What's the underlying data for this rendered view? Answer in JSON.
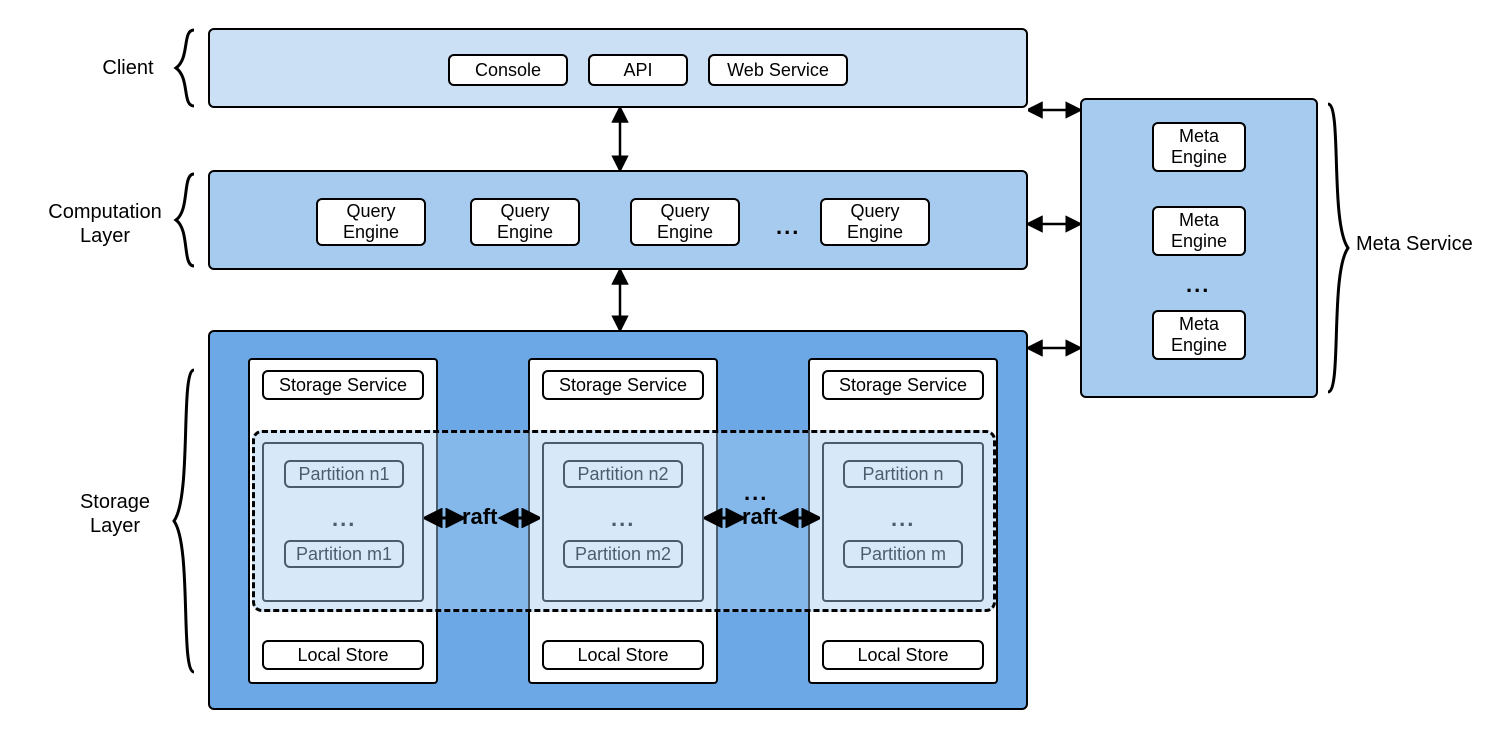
{
  "labels": {
    "client": "Client",
    "compute": "Computation\nLayer",
    "storage": "Storage\nLayer",
    "meta": "Meta Service"
  },
  "client_row": {
    "console": "Console",
    "api": "API",
    "web": "Web Service"
  },
  "compute_row": {
    "qe": "Query\nEngine"
  },
  "ellipsis": "...",
  "storage_node": {
    "svc": "Storage Service",
    "p1a": "Partition n1",
    "p1b": "Partition m1",
    "p2a": "Partition n2",
    "p2b": "Partition m2",
    "p3a": "Partition n",
    "p3b": "Partition m",
    "local": "Local Store"
  },
  "raft": "raft",
  "meta_row": {
    "me": "Meta\nEngine"
  }
}
